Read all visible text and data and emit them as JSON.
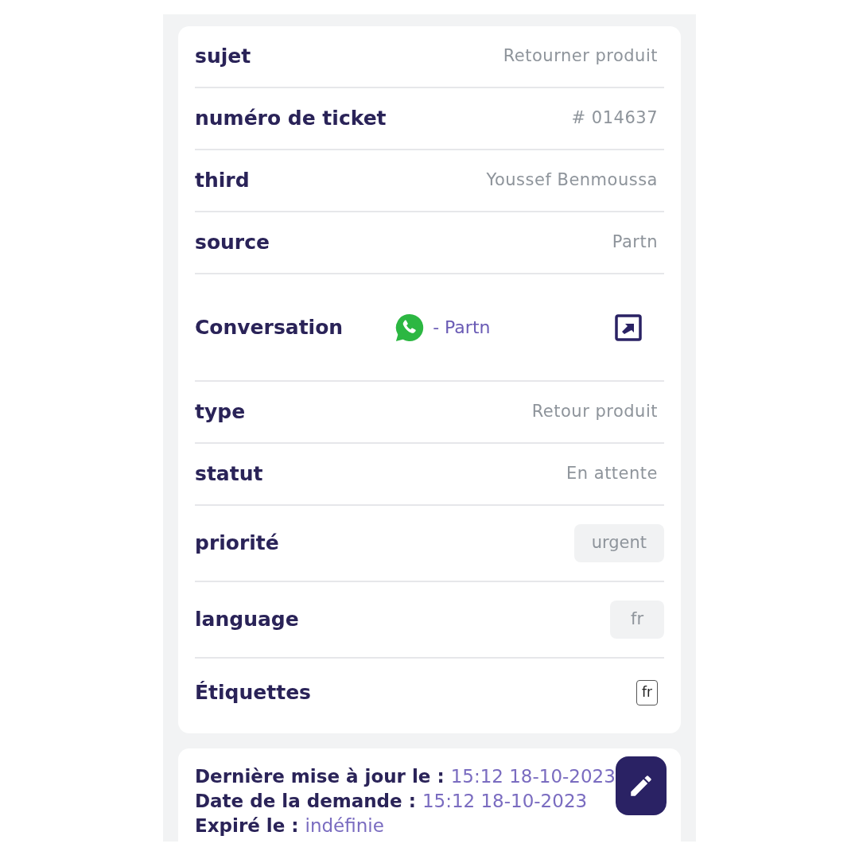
{
  "fields": [
    {
      "kind": "text",
      "label": "sujet",
      "value": "Retourner produit"
    },
    {
      "kind": "text",
      "label": "numéro de ticket",
      "value": "# 014637"
    },
    {
      "kind": "text",
      "label": "third",
      "value": "Youssef Benmoussa"
    },
    {
      "kind": "text",
      "label": "source",
      "value": "Partn"
    },
    {
      "kind": "conversation",
      "label": "Conversation",
      "value": "- Partn"
    },
    {
      "kind": "text",
      "label": "type",
      "value": "Retour produit"
    },
    {
      "kind": "text",
      "label": "statut",
      "value": "En attente"
    },
    {
      "kind": "chip",
      "label": "priorité",
      "value": "urgent"
    },
    {
      "kind": "chip",
      "label": "language",
      "value": "fr"
    },
    {
      "kind": "tag",
      "label": "Étiquettes",
      "value": "fr"
    }
  ],
  "dates": [
    {
      "label": "Dernière mise à jour le :",
      "value": "15:12 18-10-2023"
    },
    {
      "label": "Date de la demande :",
      "value": "15:12 18-10-2023"
    },
    {
      "label": "Expiré le :",
      "value": "indéfinie"
    }
  ]
}
